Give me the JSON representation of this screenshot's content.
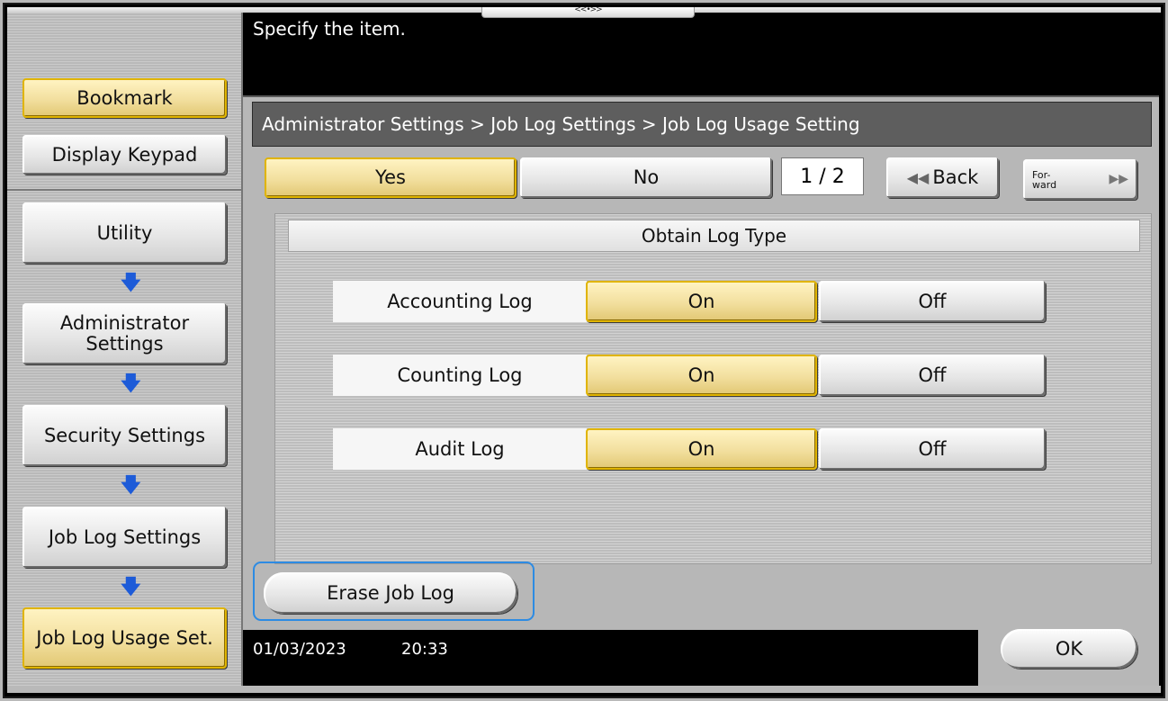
{
  "message": "Specify the item.",
  "top_tab_mark": "<<•>>",
  "sidebar": {
    "bookmark": "Bookmark",
    "display_keypad": "Display Keypad",
    "menu": [
      "Utility",
      "Administrator Settings",
      "Security Settings",
      "Job Log Settings",
      "Job Log Usage Set."
    ]
  },
  "breadcrumb": "Administrator Settings > Job Log Settings > Job Log Usage Setting",
  "yes_label": "Yes",
  "no_label": "No",
  "page_indicator": "1  / 2",
  "back_label": "Back",
  "forward_label": "For-ward",
  "section_title": "Obtain Log Type",
  "rows": [
    {
      "label": "Accounting Log",
      "on": "On",
      "off": "Off",
      "selected": "On"
    },
    {
      "label": "Counting Log",
      "on": "On",
      "off": "Off",
      "selected": "On"
    },
    {
      "label": "Audit Log",
      "on": "On",
      "off": "Off",
      "selected": "On"
    }
  ],
  "erase_label": "Erase Job Log",
  "date": "01/03/2023",
  "time": "20:33",
  "ok_label": "OK",
  "colors": {
    "selected": "#f2df9e",
    "highlight": "#2d8be3",
    "arrow": "#1d5bd8"
  }
}
